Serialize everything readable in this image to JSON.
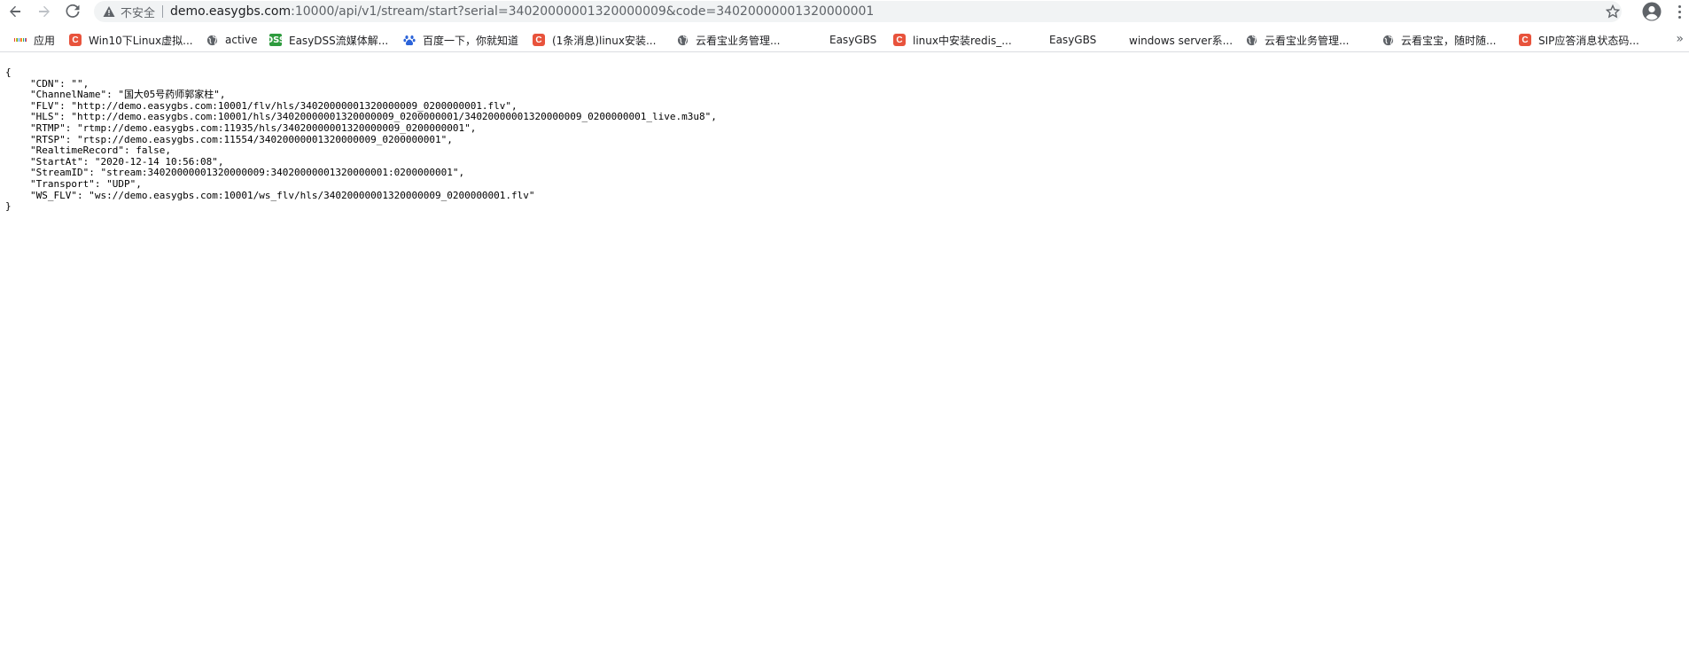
{
  "browser": {
    "security_label": "不安全",
    "url_host": "demo.easygbs.com",
    "url_rest": ":10000/api/v1/stream/start?serial=34020000001320000009&code=34020000001320000001"
  },
  "bookmarks": [
    {
      "label": "应用",
      "icon": "apps-grid-icon"
    },
    {
      "label": "Win10下Linux虚拟...",
      "icon": "csdn-icon"
    },
    {
      "label": "active",
      "icon": "globe-icon"
    },
    {
      "label": "EasyDSS流媒体解...",
      "icon": "easydss-icon"
    },
    {
      "label": "百度一下，你就知道",
      "icon": "baidu-paw-icon"
    },
    {
      "label": "(1条消息)linux安装...",
      "icon": "csdn-icon"
    },
    {
      "label": "云看宝业务管理...",
      "icon": "globe-icon"
    },
    {
      "label": "EasyGBS",
      "icon": "easygbs-t-icon"
    },
    {
      "label": "linux中安装redis_...",
      "icon": "csdn-icon"
    },
    {
      "label": "EasyGBS",
      "icon": "easygbs-t-icon"
    },
    {
      "label": "windows server系...",
      "icon": "cloud-icon"
    },
    {
      "label": "云看宝业务管理...",
      "icon": "globe-icon"
    },
    {
      "label": "云看宝宝，随时随...",
      "icon": "globe-icon"
    },
    {
      "label": "SIP应答消息状态码...",
      "icon": "csdn-icon"
    }
  ],
  "json_lines": [
    "{",
    "\"CDN\": \"\",",
    "\"ChannelName\": \"国大05号药师郭家柱\",",
    "\"FLV\": \"http://demo.easygbs.com:10001/flv/hls/34020000001320000009_0200000001.flv\",",
    "\"HLS\": \"http://demo.easygbs.com:10001/hls/34020000001320000009_0200000001/34020000001320000009_0200000001_live.m3u8\",",
    "\"RTMP\": \"rtmp://demo.easygbs.com:11935/hls/34020000001320000009_0200000001\",",
    "\"RTSP\": \"rtsp://demo.easygbs.com:11554/34020000001320000009_0200000001\",",
    "\"RealtimeRecord\": false,",
    "\"StartAt\": \"2020-12-14 10:56:08\",",
    "\"StreamID\": \"stream:34020000001320000009:34020000001320000001:0200000001\",",
    "\"Transport\": \"UDP\",",
    "\"WS_FLV\": \"ws://demo.easygbs.com:10001/ws_flv/hls/34020000001320000009_0200000001.flv\"",
    "}"
  ],
  "colors": {
    "csdn": "#e8533c",
    "toolbar_icon": "#5f6368",
    "omnibox_bg": "#f1f3f4"
  }
}
